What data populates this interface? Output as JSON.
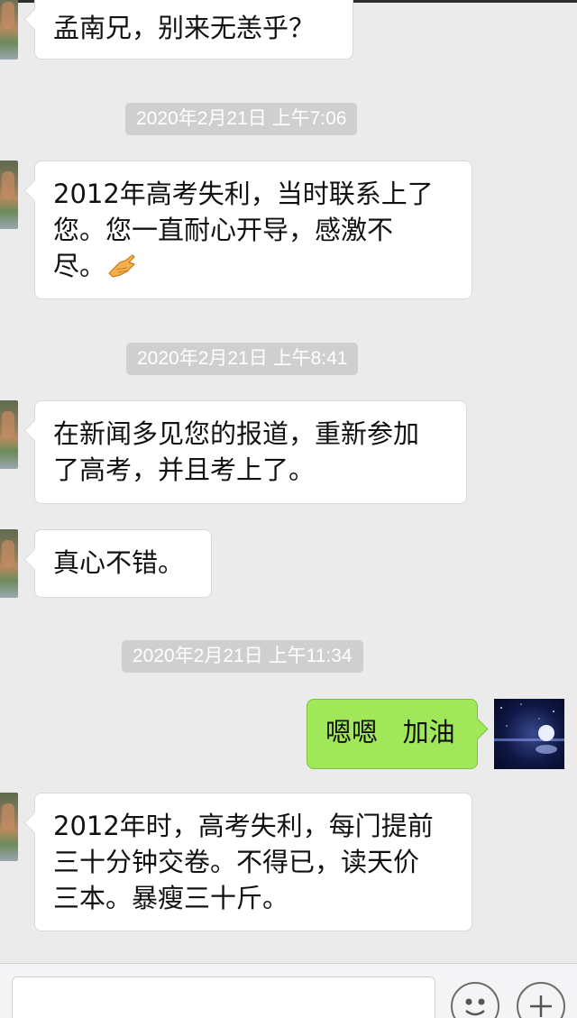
{
  "chat": {
    "messages": [
      {
        "type": "incoming",
        "text": "孟南兄，别来无恙乎？"
      },
      {
        "type": "timestamp",
        "text": "2020年2月21日 上午7:06"
      },
      {
        "type": "incoming",
        "text": "2012年高考失利，当时联系上了\n您。您一直耐心开导，感激不\n尽。",
        "emoji": "handshake-emoji"
      },
      {
        "type": "timestamp",
        "text": "2020年2月21日 上午8:41"
      },
      {
        "type": "incoming",
        "text": "在新闻多见您的报道，重新参加\n了高考，并且考上了。"
      },
      {
        "type": "incoming",
        "text": "真心不错。"
      },
      {
        "type": "timestamp",
        "text": "2020年2月21日 上午11:34"
      },
      {
        "type": "outgoing",
        "text": "嗯嗯   加油"
      },
      {
        "type": "incoming",
        "text": "2012年时，高考失利，每门提前\n三十分钟交卷。不得已，读天价\n三本。暴瘦三十斤。"
      }
    ]
  },
  "input_bar": {
    "text_value": "",
    "icons": [
      "emoji-icon",
      "add-icon"
    ]
  },
  "colors": {
    "background": "#ebebeb",
    "incoming_bubble": "#ffffff",
    "outgoing_bubble": "#a0e75a",
    "timestamp_bg": "#cfcfcf",
    "timestamp_text": "#ffffff"
  }
}
